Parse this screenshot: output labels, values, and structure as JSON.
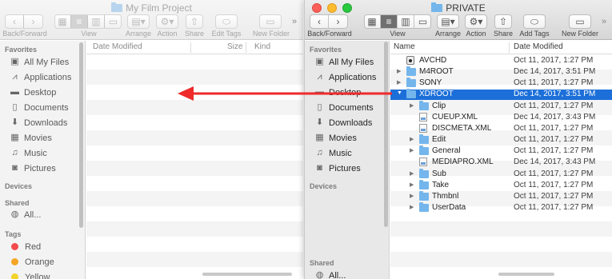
{
  "left_window": {
    "title": "My Film Project",
    "toolbar": {
      "back_forward_label": "Back/Forward",
      "view_label": "View",
      "arrange_label": "Arrange",
      "action_label": "Action",
      "share_label": "Share",
      "edit_tags_label": "Edit Tags",
      "new_folder_label": "New Folder",
      "overflow": "»"
    },
    "sidebar": {
      "favorites_header": "Favorites",
      "favorites": [
        "All My Files",
        "Applications",
        "Desktop",
        "Documents",
        "Downloads",
        "Movies",
        "Music",
        "Pictures"
      ],
      "devices_header": "Devices",
      "shared_header": "Shared",
      "shared_item": "All...",
      "tags_header": "Tags",
      "tags": [
        {
          "label": "Red",
          "color": "#f34b4b"
        },
        {
          "label": "Orange",
          "color": "#f5a623"
        },
        {
          "label": "Yellow",
          "color": "#f2d32b"
        }
      ]
    },
    "columns": {
      "date_modified": "Date Modified",
      "size": "Size",
      "kind": "Kind"
    }
  },
  "right_window": {
    "title": "PRIVATE",
    "toolbar": {
      "back_forward_label": "Back/Forward",
      "view_label": "View",
      "arrange_label": "Arrange",
      "action_label": "Action",
      "share_label": "Share",
      "add_tags_label": "Add Tags",
      "new_folder_label": "New Folder",
      "overflow": "»"
    },
    "sidebar": {
      "favorites_header": "Favorites",
      "favorites": [
        "All My Files",
        "Applications",
        "Desktop",
        "Documents",
        "Downloads",
        "Movies",
        "Music",
        "Pictures"
      ],
      "devices_header": "Devices",
      "shared_header": "Shared",
      "shared_item": "All..."
    },
    "columns": {
      "name": "Name",
      "date_modified": "Date Modified"
    },
    "files": [
      {
        "name": "AVCHD",
        "date": "Oct 11, 2017, 1:27 PM",
        "kind": "disk",
        "indent": 0,
        "expander": "none",
        "selected": false
      },
      {
        "name": "M4ROOT",
        "date": "Dec 14, 2017, 3:51 PM",
        "kind": "folder",
        "indent": 0,
        "expander": "collapsed",
        "selected": false
      },
      {
        "name": "SONY",
        "date": "Oct 11, 2017, 1:27 PM",
        "kind": "folder",
        "indent": 0,
        "expander": "collapsed",
        "selected": false
      },
      {
        "name": "XDROOT",
        "date": "Dec 14, 2017, 3:51 PM",
        "kind": "folder",
        "indent": 0,
        "expander": "expanded",
        "selected": true
      },
      {
        "name": "Clip",
        "date": "Oct 11, 2017, 1:27 PM",
        "kind": "folder",
        "indent": 1,
        "expander": "collapsed",
        "selected": false
      },
      {
        "name": "CUEUP.XML",
        "date": "Dec 14, 2017, 3:43 PM",
        "kind": "file",
        "indent": 1,
        "expander": "none",
        "selected": false
      },
      {
        "name": "DISCMETA.XML",
        "date": "Oct 11, 2017, 1:27 PM",
        "kind": "file",
        "indent": 1,
        "expander": "none",
        "selected": false
      },
      {
        "name": "Edit",
        "date": "Oct 11, 2017, 1:27 PM",
        "kind": "folder",
        "indent": 1,
        "expander": "collapsed",
        "selected": false
      },
      {
        "name": "General",
        "date": "Oct 11, 2017, 1:27 PM",
        "kind": "folder",
        "indent": 1,
        "expander": "collapsed",
        "selected": false
      },
      {
        "name": "MEDIAPRO.XML",
        "date": "Dec 14, 2017, 3:43 PM",
        "kind": "file",
        "indent": 1,
        "expander": "none",
        "selected": false
      },
      {
        "name": "Sub",
        "date": "Oct 11, 2017, 1:27 PM",
        "kind": "folder",
        "indent": 1,
        "expander": "collapsed",
        "selected": false
      },
      {
        "name": "Take",
        "date": "Oct 11, 2017, 1:27 PM",
        "kind": "folder",
        "indent": 1,
        "expander": "collapsed",
        "selected": false
      },
      {
        "name": "Thmbnl",
        "date": "Oct 11, 2017, 1:27 PM",
        "kind": "folder",
        "indent": 1,
        "expander": "collapsed",
        "selected": false
      },
      {
        "name": "UserData",
        "date": "Oct 11, 2017, 1:27 PM",
        "kind": "folder",
        "indent": 1,
        "expander": "collapsed",
        "selected": false
      }
    ]
  },
  "colors": {
    "selection": "#1c6fd8",
    "arrow": "#ee2a2a",
    "folder": "#74b6ec"
  },
  "icons": {
    "all_my_files": "all-my-files-icon",
    "applications": "applications-icon",
    "desktop": "desktop-icon",
    "documents": "documents-icon",
    "downloads": "downloads-icon",
    "movies": "movies-icon",
    "music": "music-icon",
    "pictures": "pictures-icon"
  }
}
